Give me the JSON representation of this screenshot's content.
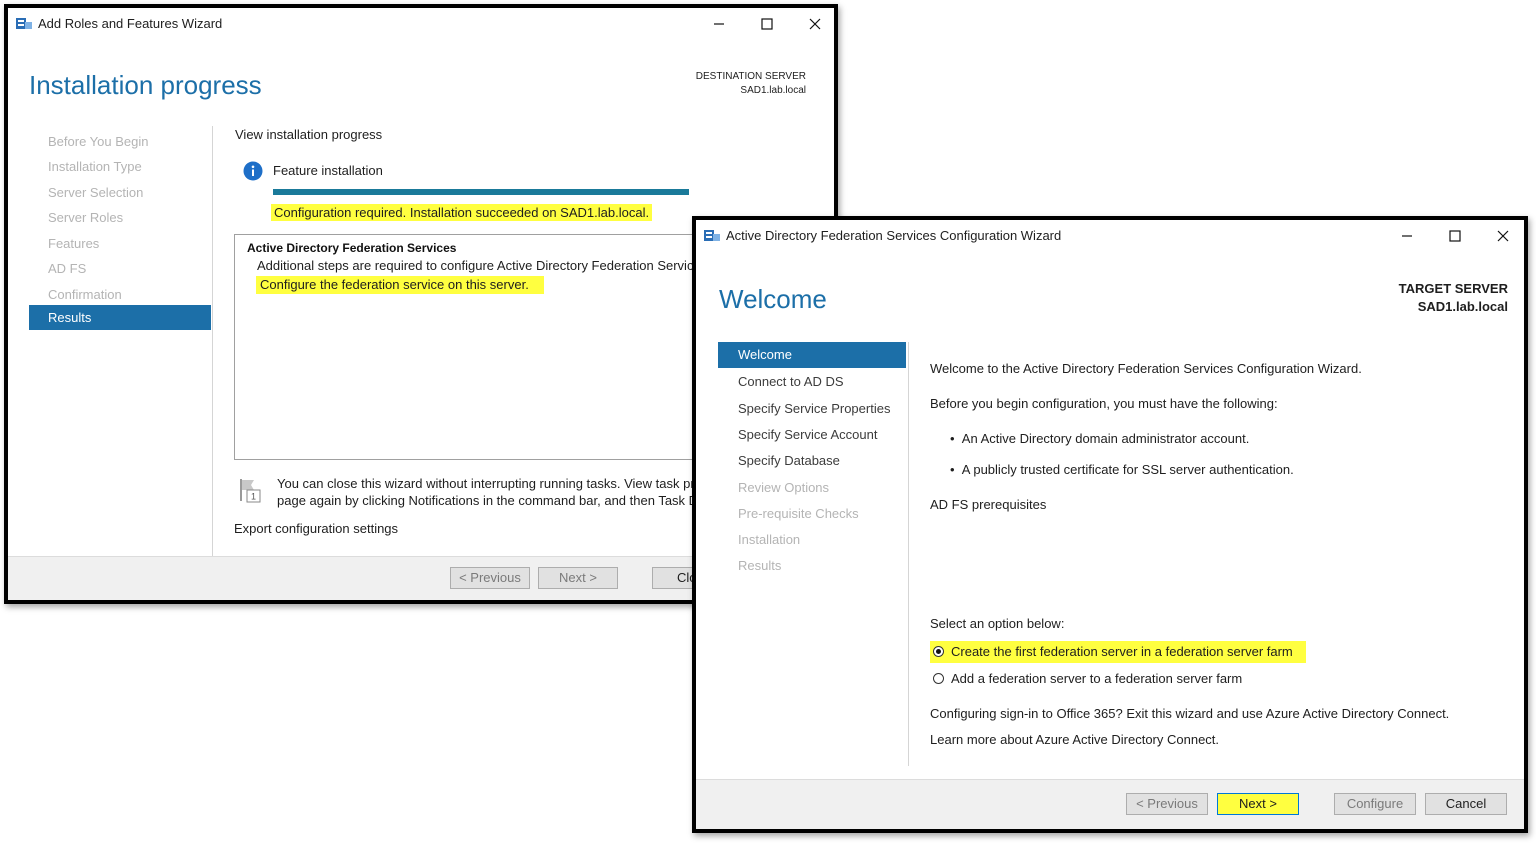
{
  "win1": {
    "title": "Add Roles and Features Wizard",
    "heading": "Installation progress",
    "server_label": "DESTINATION SERVER",
    "server_name": "SAD1.lab.local",
    "nav": [
      {
        "label": "Before You Begin"
      },
      {
        "label": "Installation Type"
      },
      {
        "label": "Server Selection"
      },
      {
        "label": "Server Roles"
      },
      {
        "label": "Features"
      },
      {
        "label": "AD FS"
      },
      {
        "label": "Confirmation"
      },
      {
        "label": "Results"
      }
    ],
    "view_label": "View installation progress",
    "feature_label": "Feature installation",
    "progress": 1.0,
    "status": "Configuration required. Installation succeeded on SAD1.lab.local.",
    "box_title": "Active Directory Federation Services",
    "box_line": "Additional steps are required to configure Active Directory Federation Services",
    "box_link": "Configure the federation service on this server.",
    "note_line1": "You can close this wizard without interrupting running tasks. View task prog",
    "note_line2": "page again by clicking Notifications in the command bar, and then Task De",
    "export_link": "Export configuration settings",
    "buttons": {
      "previous": "< Previous",
      "next": "Next >",
      "close": "Clo"
    }
  },
  "win2": {
    "title": "Active Directory Federation Services Configuration Wizard",
    "heading": "Welcome",
    "server_label": "TARGET SERVER",
    "server_name": "SAD1.lab.local",
    "nav": [
      {
        "label": "Welcome"
      },
      {
        "label": "Connect to AD DS"
      },
      {
        "label": "Specify Service Properties"
      },
      {
        "label": "Specify Service Account"
      },
      {
        "label": "Specify Database"
      },
      {
        "label": "Review Options"
      },
      {
        "label": "Pre-requisite Checks"
      },
      {
        "label": "Installation"
      },
      {
        "label": "Results"
      }
    ],
    "intro": "Welcome to the Active Directory Federation Services Configuration Wizard.",
    "before": "Before you begin configuration, you must have the following:",
    "bullets": [
      "An Active Directory domain administrator account.",
      "A publicly trusted certificate for SSL server authentication."
    ],
    "prereq_link": "AD FS prerequisites",
    "select_label": "Select an option below:",
    "options": [
      {
        "label": "Create the first federation server in a federation server farm",
        "selected": true
      },
      {
        "label": "Add a federation server to a federation server farm",
        "selected": false
      }
    ],
    "o365": "Configuring sign-in to Office 365? Exit this wizard and use Azure Active Directory Connect.",
    "learn_link": "Learn more about Azure Active Directory Connect.",
    "buttons": {
      "previous": "< Previous",
      "next": "Next >",
      "configure": "Configure",
      "cancel": "Cancel"
    }
  }
}
